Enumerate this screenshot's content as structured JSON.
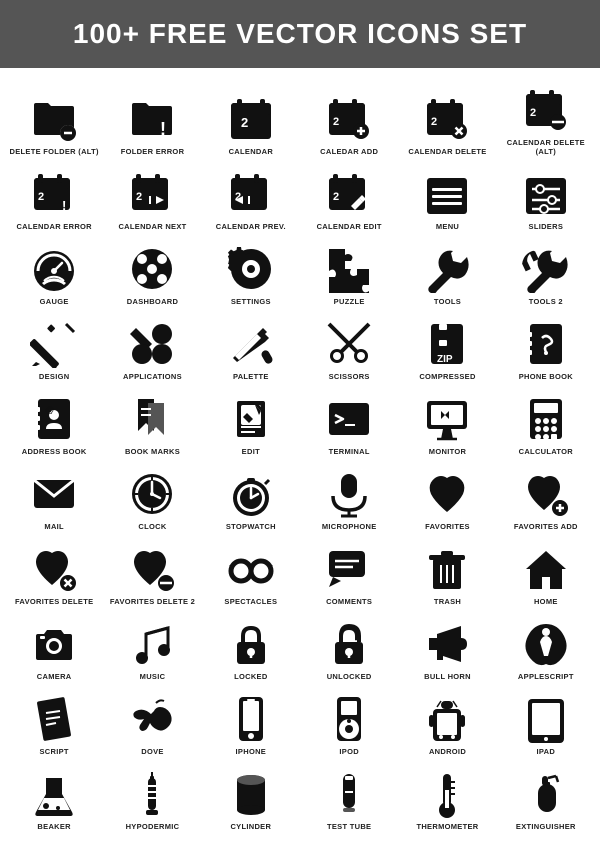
{
  "header": {
    "title": "100+ FREE VECTOR ICONS SET"
  },
  "icons": [
    {
      "id": "delete-folder-alt",
      "label": "DELETE FOLDER (alt)"
    },
    {
      "id": "folder-error",
      "label": "FOLDER ERROR"
    },
    {
      "id": "calendar",
      "label": "CALENDAR"
    },
    {
      "id": "calendar-add",
      "label": "CALEDAR ADD"
    },
    {
      "id": "calendar-delete",
      "label": "CALENDAR DELETE"
    },
    {
      "id": "calendar-delete-alt",
      "label": "CALENDAR DELETE (alt)"
    },
    {
      "id": "calendar-error",
      "label": "CALENDAR ERROR"
    },
    {
      "id": "calendar-next",
      "label": "CALENDAR NEXT"
    },
    {
      "id": "calendar-prev",
      "label": "CALENDAR PREV."
    },
    {
      "id": "calendar-edit",
      "label": "CALENDAR EDIT"
    },
    {
      "id": "menu",
      "label": "MENU"
    },
    {
      "id": "sliders",
      "label": "SLIDERS"
    },
    {
      "id": "gauge",
      "label": "GAUGE"
    },
    {
      "id": "dashboard",
      "label": "DASHBOARD"
    },
    {
      "id": "settings",
      "label": "SETTINGS"
    },
    {
      "id": "puzzle",
      "label": "PUZZLE"
    },
    {
      "id": "tools",
      "label": "TOOLS"
    },
    {
      "id": "tools2",
      "label": "TOOLS 2"
    },
    {
      "id": "design",
      "label": "DESIGN"
    },
    {
      "id": "applications",
      "label": "APPLICATIONS"
    },
    {
      "id": "palette",
      "label": "PALETTE"
    },
    {
      "id": "scissors",
      "label": "SCISSORS"
    },
    {
      "id": "compressed",
      "label": "COMPRESSED"
    },
    {
      "id": "phone-book",
      "label": "PHONE BOOK"
    },
    {
      "id": "address-book",
      "label": "ADDRESS BOOK"
    },
    {
      "id": "bookmarks",
      "label": "BOOK MARKS"
    },
    {
      "id": "edit",
      "label": "EDIT"
    },
    {
      "id": "terminal",
      "label": "TERMINAL"
    },
    {
      "id": "monitor",
      "label": "MONITOR"
    },
    {
      "id": "calculator",
      "label": "CALCULATOR"
    },
    {
      "id": "mail",
      "label": "MAIL"
    },
    {
      "id": "clock",
      "label": "CLOCK"
    },
    {
      "id": "stopwatch",
      "label": "STOPWATCH"
    },
    {
      "id": "microphone",
      "label": "MICROPHONE"
    },
    {
      "id": "favorites",
      "label": "FAVORITES"
    },
    {
      "id": "favorites-add",
      "label": "FAVORITES ADD"
    },
    {
      "id": "favorites-delete",
      "label": "FAVORITES DELETE"
    },
    {
      "id": "favorites-delete2",
      "label": "FAVORITES DELETE 2"
    },
    {
      "id": "spectacles",
      "label": "SPECTACLES"
    },
    {
      "id": "comments",
      "label": "COMMENTS"
    },
    {
      "id": "trash",
      "label": "TRASH"
    },
    {
      "id": "home",
      "label": "HOME"
    },
    {
      "id": "camera",
      "label": "CAMERA"
    },
    {
      "id": "music",
      "label": "MUSIC"
    },
    {
      "id": "locked",
      "label": "LOCKED"
    },
    {
      "id": "unlocked",
      "label": "UNLOCKED"
    },
    {
      "id": "bull-horn",
      "label": "BULL HORN"
    },
    {
      "id": "applescript",
      "label": "APPLESCRIPT"
    },
    {
      "id": "script",
      "label": "SCRIPT"
    },
    {
      "id": "dove",
      "label": "DOVE"
    },
    {
      "id": "iphone",
      "label": "iPHONE"
    },
    {
      "id": "ipod",
      "label": "iPOD"
    },
    {
      "id": "android",
      "label": "ANDROID"
    },
    {
      "id": "ipad",
      "label": "iPad"
    },
    {
      "id": "beaker",
      "label": "BEAKER"
    },
    {
      "id": "hypodermic",
      "label": "HYPODERMIC"
    },
    {
      "id": "cylinder",
      "label": "CYLINDER"
    },
    {
      "id": "test-tube",
      "label": "TEST TUBE"
    },
    {
      "id": "thermometer",
      "label": "THERMOMETER"
    },
    {
      "id": "extinguisher",
      "label": "EXTINGUISHER"
    }
  ]
}
